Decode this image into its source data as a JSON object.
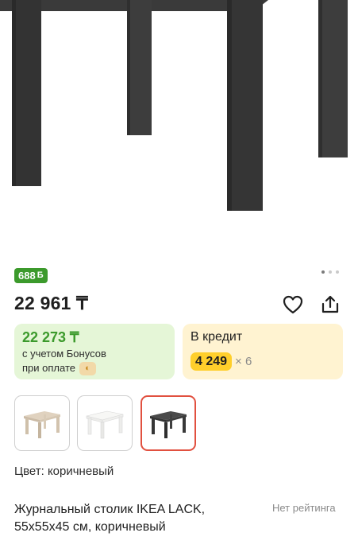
{
  "gallery": {
    "dots": 3,
    "active_dot": 0
  },
  "bonus_badge": {
    "amount": "688",
    "icon": "bonus-b-icon"
  },
  "price": "22 961 ₸",
  "actions": {
    "favorite_icon": "heart-icon",
    "share_icon": "share-icon"
  },
  "bonus_card": {
    "price": "22 273 ₸",
    "line1": "с учетом Бонусов",
    "line2": "при оплате",
    "icon": "payment-service-icon"
  },
  "credit_card": {
    "title": "В кредит",
    "amount": "4 249",
    "times": "× 6"
  },
  "color_options": [
    {
      "name": "beige",
      "selected": false
    },
    {
      "name": "white",
      "selected": false
    },
    {
      "name": "brown",
      "selected": true
    }
  ],
  "color_label": "Цвет: коричневый",
  "product_title": "Журнальный столик IKEA LACK, 55x55x45 см, коричневый",
  "rating_text": "Нет рейтинга",
  "colors": {
    "accent_green": "#3c9a2c",
    "bonus_bg": "#e5f6d7",
    "credit_bg": "#fff3d1",
    "credit_badge": "#ffcf2b",
    "selected_border": "#e1503f",
    "table_brown": "#3b3b3b"
  }
}
